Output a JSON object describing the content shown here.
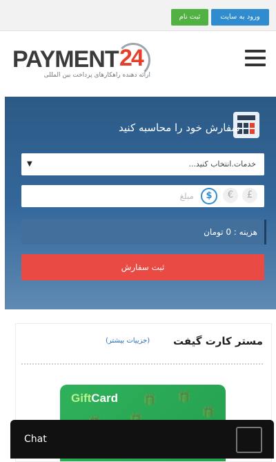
{
  "topbar": {
    "login_label": "ورود به سایت",
    "register_label": "ثبت نام"
  },
  "brand": {
    "name_part": "PAYMENT",
    "number_part": "24",
    "tagline": "ارائه دهنده راهکارهای پرداخت بین المللی"
  },
  "calculator": {
    "title": "سفارش خود را محاسبه کنید",
    "service_select": {
      "value": "خدمات.انتخاب کنید...",
      "arrow": "▼"
    },
    "amount": {
      "placeholder": "مبلغ",
      "currencies": [
        {
          "symbol": "£",
          "active": false
        },
        {
          "symbol": "€",
          "active": false
        },
        {
          "symbol": "$",
          "active": true
        }
      ]
    },
    "cost_text": "هزینه : 0 تومان",
    "submit_label": "ثبت سفارش"
  },
  "product": {
    "title": "مستر کارت گیفت",
    "more_link": "(جزییات بیشتر)",
    "card_logo_part1": "Gift",
    "card_logo_part2": "Card"
  },
  "chat": {
    "label": "Chat"
  },
  "colors": {
    "login_blue": "#2f8ccf",
    "register_green": "#51b142",
    "panel_blue": "#33679a",
    "order_red": "#e94a43",
    "gift_green": "#2fb15b"
  }
}
